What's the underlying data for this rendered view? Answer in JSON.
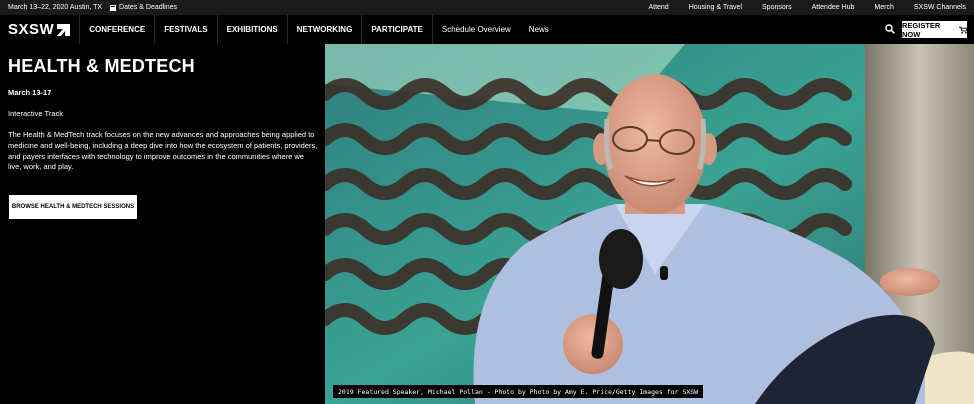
{
  "utility": {
    "date_location": "March 13–22, 2020 Austin, TX",
    "dates_link": "Dates & Deadlines",
    "links": [
      "Attend",
      "Housing & Travel",
      "Sponsors",
      "Attendee Hub",
      "Merch",
      "SXSW Channels"
    ]
  },
  "nav": {
    "logo": "SXSW",
    "items": [
      "CONFERENCE",
      "FESTIVALS",
      "EXHIBITIONS",
      "NETWORKING",
      "PARTICIPATE"
    ],
    "secondary": [
      "Schedule Overview",
      "News"
    ],
    "register": "REGISTER NOW"
  },
  "hero": {
    "title": "HEALTH & MEDTECH",
    "dates": "March 13-17",
    "track": "Interactive Track",
    "description": "The Health & MedTech track focuses on the new advances and approaches being applied to medicine and well-being, including a deep dive into how the ecosystem of patients, providers, and payers interfaces with technology to improve outcomes in the communities where we live, work, and play.",
    "button": "BROWSE HEALTH & MEDTECH SESSIONS",
    "caption": "2019 Featured Speaker, Michael Pollan - Photo by Photo by Amy E. Price/Getty Images for SXSW"
  },
  "colors": {
    "background": "#000000",
    "utility_bar": "#1a1a1a",
    "backdrop_teal": "#3aa393",
    "shirt_blue": "#aebfe0"
  },
  "icons": [
    "calendar-icon",
    "sxsw-arrow-icon",
    "search-icon",
    "cart-icon"
  ]
}
